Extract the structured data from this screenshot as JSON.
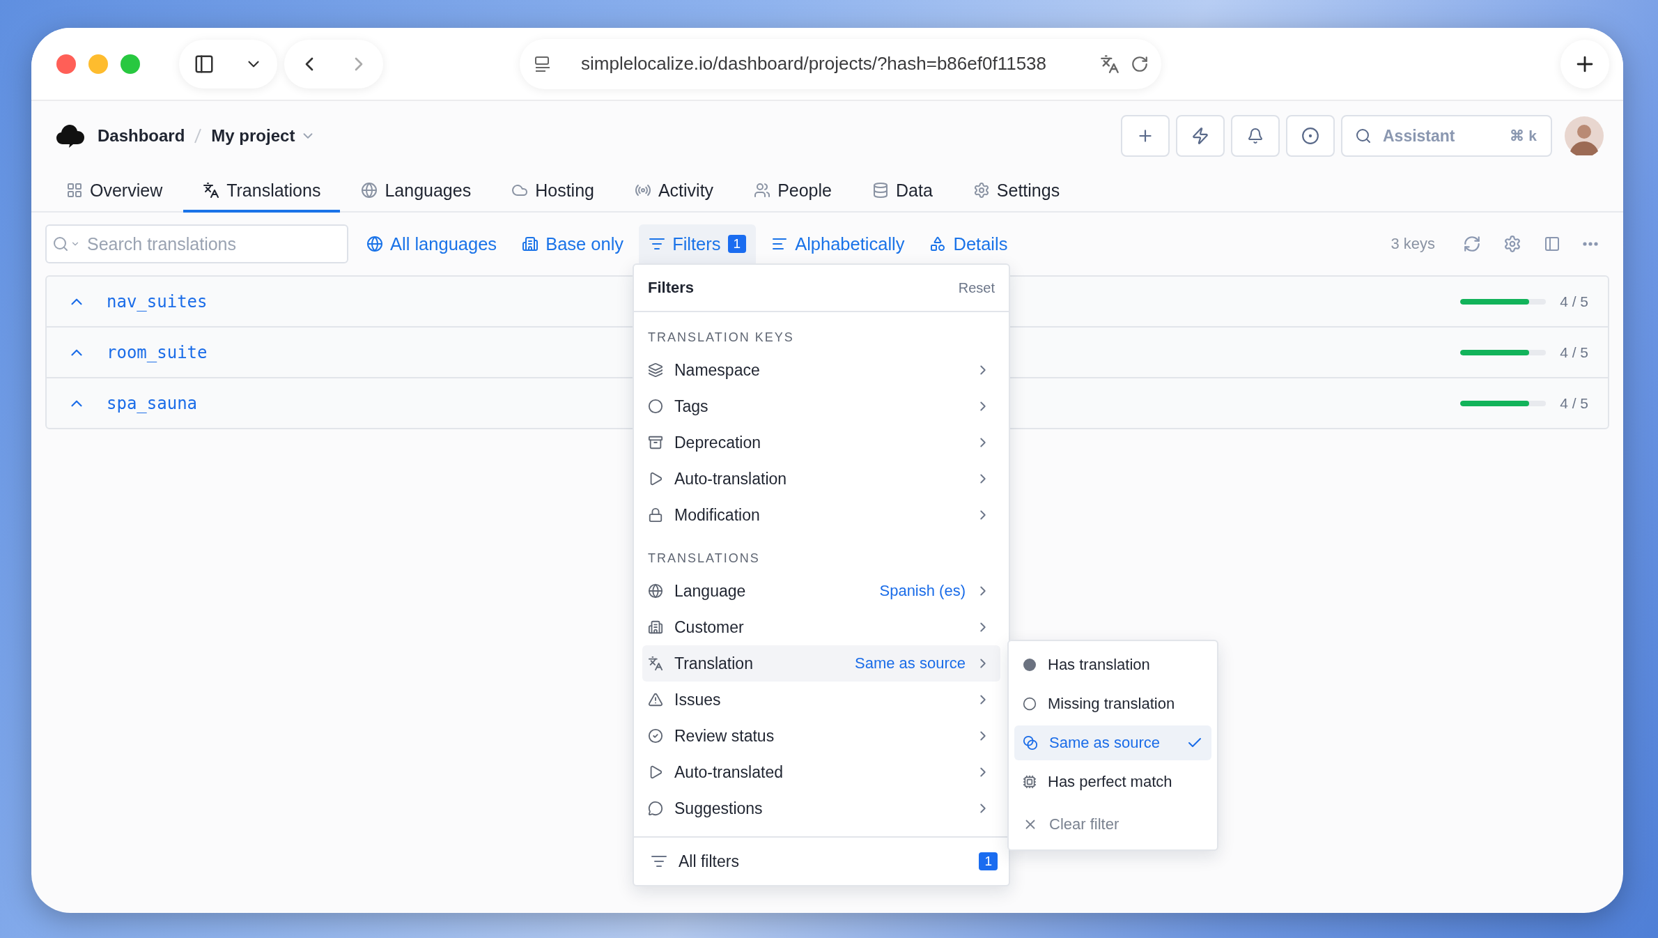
{
  "browser": {
    "url": "simplelocalize.io/dashboard/projects/?hash=b86ef0f11538"
  },
  "breadcrumb": [
    {
      "label": "Dashboard"
    },
    {
      "label": "My project"
    }
  ],
  "assistant": {
    "placeholder": "Assistant",
    "shortcut": "⌘ k"
  },
  "tabs": [
    {
      "label": "Overview",
      "selected": false
    },
    {
      "label": "Translations",
      "selected": true
    },
    {
      "label": "Languages",
      "selected": false
    },
    {
      "label": "Hosting",
      "selected": false
    },
    {
      "label": "Activity",
      "selected": false
    },
    {
      "label": "People",
      "selected": false
    },
    {
      "label": "Data",
      "selected": false
    },
    {
      "label": "Settings",
      "selected": false
    }
  ],
  "toolbar": {
    "search": {
      "placeholder": "Search translations"
    },
    "buttons": [
      {
        "label": "All languages",
        "expanded": false
      },
      {
        "label": "Base only",
        "expanded": false
      },
      {
        "label": "Filters",
        "badge": "1",
        "expanded": true
      },
      {
        "label": "Alphabetically",
        "expanded": false
      },
      {
        "label": "Details",
        "expanded": false
      }
    ],
    "key_count": "3 keys"
  },
  "rows": [
    {
      "key": "nav_suites",
      "level": 0.8,
      "reading": "4 / 5"
    },
    {
      "key": "room_suite",
      "level": 0.8,
      "reading": "4 / 5"
    },
    {
      "key": "spa_sauna",
      "level": 0.8,
      "reading": "4 / 5"
    }
  ],
  "filter_menu": {
    "title": "Filters",
    "reset": "Reset",
    "sections": [
      {
        "heading": "TRANSLATION KEYS",
        "items": [
          {
            "label": "Namespace",
            "expanded": false
          },
          {
            "label": "Tags",
            "expanded": false
          },
          {
            "label": "Deprecation",
            "expanded": false
          },
          {
            "label": "Auto-translation",
            "expanded": false
          },
          {
            "label": "Modification",
            "expanded": false
          }
        ]
      },
      {
        "heading": "TRANSLATIONS",
        "items": [
          {
            "label": "Language",
            "value": "Spanish (es)",
            "expanded": false
          },
          {
            "label": "Customer",
            "expanded": false
          },
          {
            "label": "Translation",
            "value": "Same as source",
            "expanded": true
          },
          {
            "label": "Issues",
            "expanded": false
          },
          {
            "label": "Review status",
            "expanded": false
          },
          {
            "label": "Auto-translated",
            "expanded": false
          },
          {
            "label": "Suggestions",
            "expanded": false
          }
        ]
      }
    ],
    "footer": {
      "label": "All filters",
      "badge": "1"
    }
  },
  "submenu": {
    "items": [
      {
        "label": "Has translation",
        "selected": false
      },
      {
        "label": "Missing translation",
        "selected": false
      },
      {
        "label": "Same as source",
        "selected": true
      },
      {
        "label": "Has perfect match",
        "selected": false
      }
    ],
    "clear": "Clear filter"
  }
}
